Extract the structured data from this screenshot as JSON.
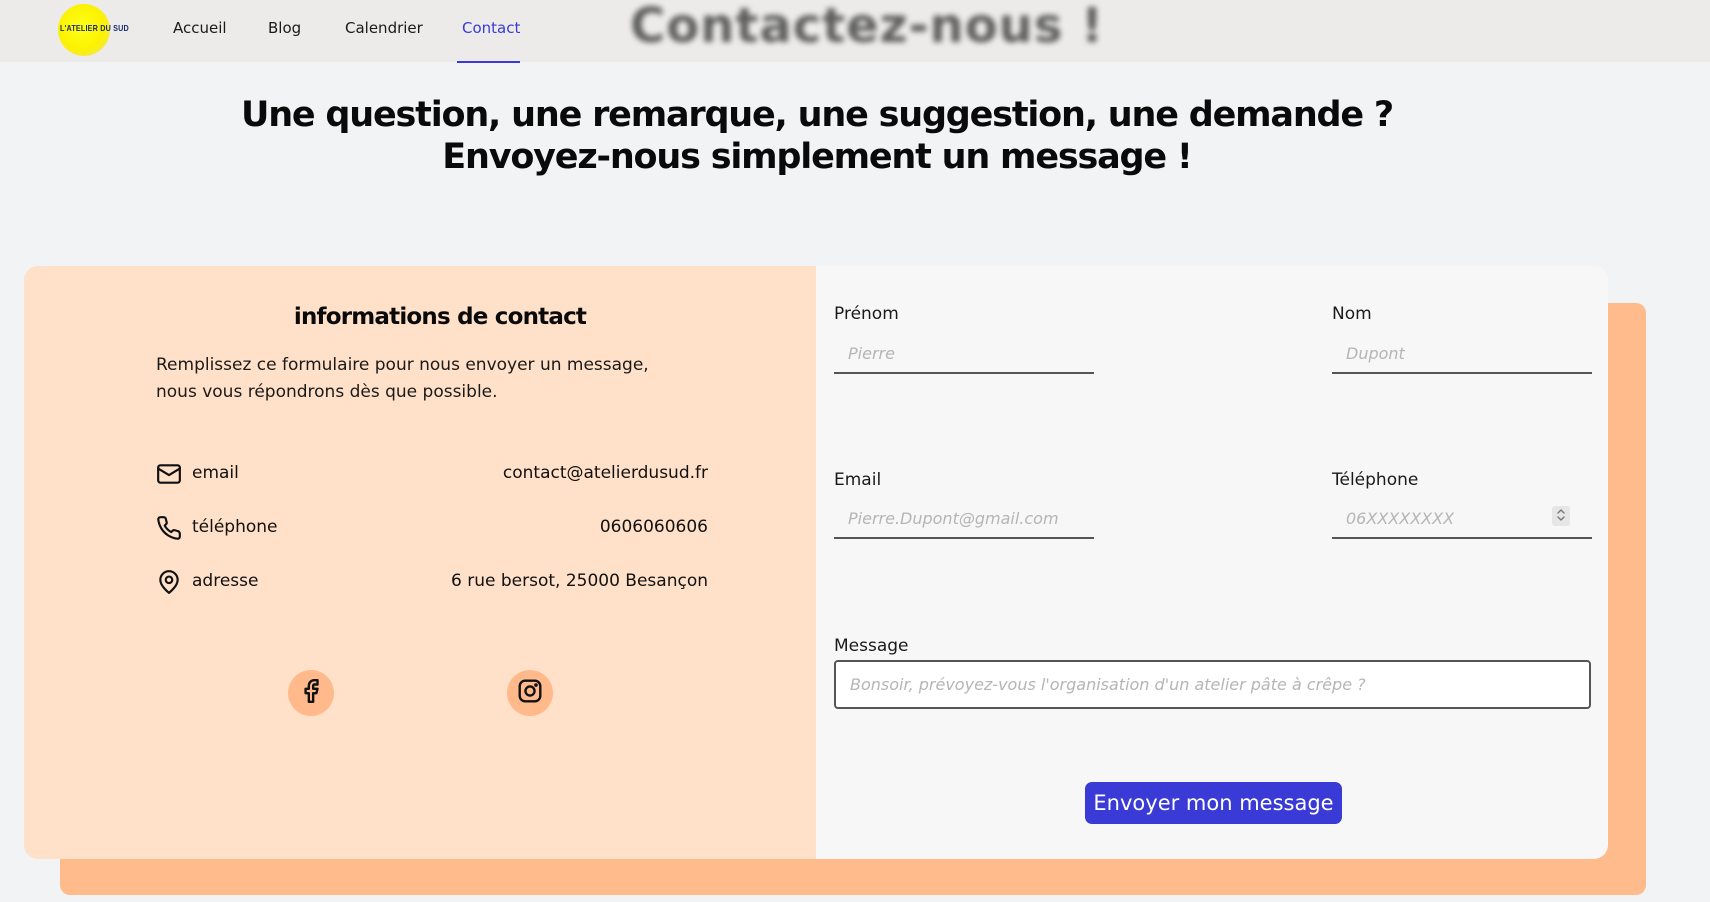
{
  "nav": {
    "logo_text": "L'ATELIER DU SUD",
    "links": [
      "Accueil",
      "Blog",
      "Calendrier",
      "Contact"
    ],
    "active": "Contact",
    "ghost_title": "Contactez-nous !"
  },
  "headline": {
    "line1": "Une question, une remarque, une suggestion, une demande ?",
    "line2": "Envoyez-nous simplement un message !"
  },
  "info": {
    "title": "informations de contact",
    "description": "Remplissez ce formulaire pour nous envoyer un message, nous vous répondrons dès que possible.",
    "rows": [
      {
        "icon": "mail-icon",
        "label": "email",
        "value": "contact@atelierdusud.fr"
      },
      {
        "icon": "phone-icon",
        "label": "téléphone",
        "value": "0606060606"
      },
      {
        "icon": "map-pin-icon",
        "label": "adresse",
        "value": "6 rue bersot, 25000 Besançon"
      }
    ],
    "social": [
      "facebook-icon",
      "instagram-icon"
    ]
  },
  "form": {
    "prenom": {
      "label": "Prénom",
      "placeholder": "Pierre"
    },
    "nom": {
      "label": "Nom",
      "placeholder": "Dupont"
    },
    "email": {
      "label": "Email",
      "placeholder": "Pierre.Dupont@gmail.com"
    },
    "telephone": {
      "label": "Téléphone",
      "placeholder": "06XXXXXXXX"
    },
    "message": {
      "label": "Message",
      "placeholder": "Bonsoir, prévoyez-vous l'organisation d'un atelier pâte à crêpe ?"
    },
    "submit_label": "Envoyer mon message"
  },
  "colors": {
    "accent": "#3a3ad6",
    "info_bg": "#ffe0c8",
    "shadow_bg": "#ffbb8b",
    "social_bg": "#ffb98a"
  }
}
